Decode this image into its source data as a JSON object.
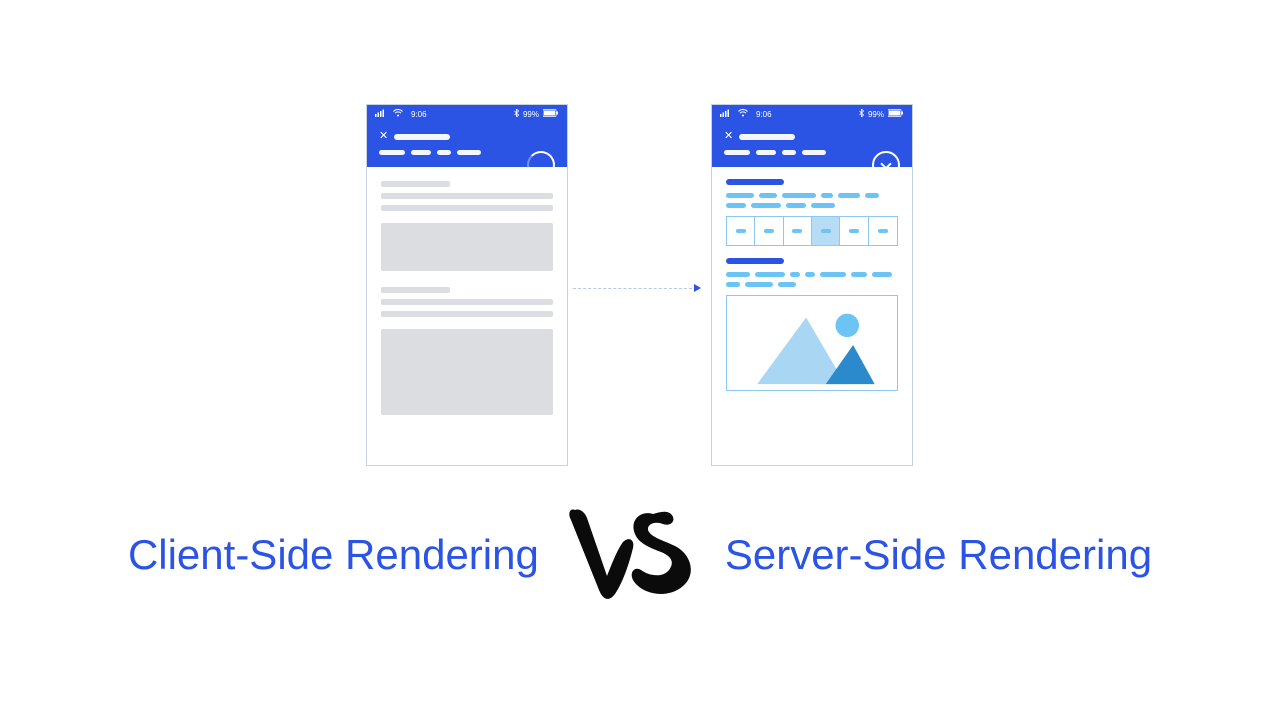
{
  "statusbar": {
    "time": "9:06",
    "battery": "99%"
  },
  "labels": {
    "left": "Client-Side Rendering",
    "right": "Server-Side Rendering",
    "vs": "VS"
  },
  "colors": {
    "brand_blue": "#2B54E5",
    "light_blue": "#6cc4f5",
    "skeleton_grey": "#dbdde1",
    "sky": "#b7dcf5"
  }
}
